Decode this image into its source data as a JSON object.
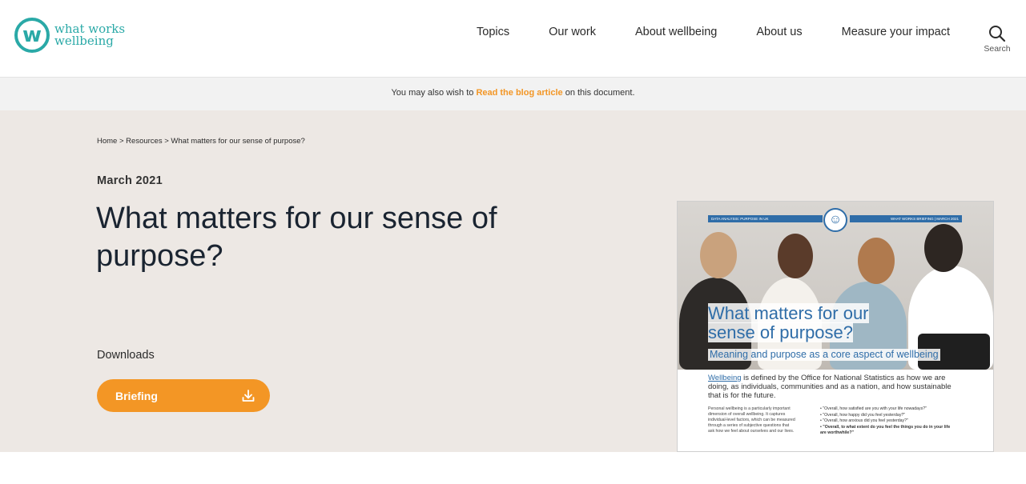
{
  "header": {
    "logo": {
      "line1": "what works",
      "line2": "wellbeing",
      "mark": "w"
    },
    "nav": [
      "Topics",
      "Our work",
      "About wellbeing",
      "About us",
      "Measure your impact"
    ],
    "search_label": "Search"
  },
  "notice": {
    "before": "You may also wish to ",
    "link": "Read the blog article",
    "after": " on this document."
  },
  "breadcrumb": {
    "home": "Home",
    "sep": " > ",
    "resources": "Resources",
    "current": "What matters for our sense of purpose?"
  },
  "page": {
    "date": "March 2021",
    "title": "What matters for our sense of purpose?",
    "downloads_label": "Downloads",
    "briefing_button": "Briefing"
  },
  "cover": {
    "band_left": "DATA ANALYSIS: PURPOSE IN UK",
    "band_right": "WHAT WORKS BRIEFING | MARCH 2021",
    "title_line1": "What matters for our",
    "title_line2": "sense of purpose?",
    "subtitle": "Meaning and purpose as a core aspect of wellbeing",
    "lead_link": "Wellbeing",
    "lead_rest": " is defined by the Office for National Statistics as how we are doing, as individuals, communities and as a nation, and how sustainable that is for the future.",
    "col1": "Personal wellbeing is a particularly important dimension of overall wellbeing. It captures individual-level factors, which can be measured through a series of subjective questions that ask how we feel about ourselves and our lives.",
    "questions": [
      "• \"Overall, how satisfied are you with your life nowadays?\"",
      "• \"Overall, how happy did you feel yesterday?\"",
      "• \"Overall, how anxious did you feel yesterday?\"",
      "• \"Overall, to what extent do you feel the things you do in your life",
      "   are worthwhile?\""
    ]
  },
  "colors": {
    "accent_orange": "#f39625",
    "brand_teal": "#2aa9a7",
    "cover_blue": "#2f6da8",
    "page_bg": "#ede8e4"
  }
}
